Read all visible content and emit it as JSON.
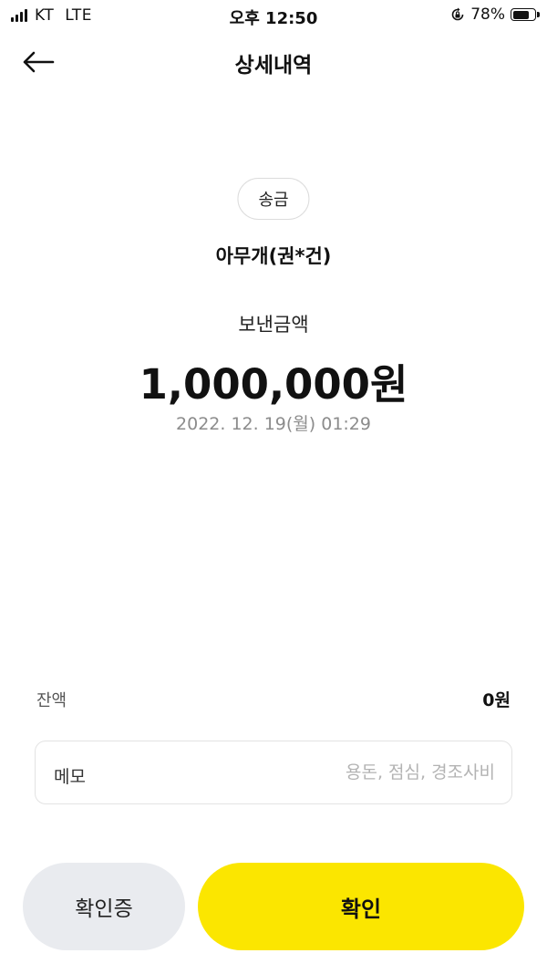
{
  "status_bar": {
    "carrier": "KT",
    "network": "LTE",
    "time": "오후 12:50",
    "battery_percent": "78%",
    "battery_level": 0.78,
    "icons": [
      "signal-icon",
      "rotation-lock-icon",
      "battery-icon"
    ]
  },
  "header": {
    "title": "상세내역",
    "back_icon": "arrow-left-icon"
  },
  "transaction": {
    "type": "송금",
    "recipient": "아무개(권*건)",
    "amount_label": "보낸금액",
    "amount": "1,000,000원",
    "datetime": "2022. 12. 19(월) 01:29"
  },
  "balance": {
    "label": "잔액",
    "value": "0원"
  },
  "memo": {
    "label": "메모",
    "placeholder": "용돈, 점심, 경조사비",
    "value": ""
  },
  "buttons": {
    "receipt_label": "확인증",
    "confirm_label": "확인"
  },
  "colors": {
    "accent_yellow": "#fbe600",
    "secondary_button": "#e9ebef",
    "muted_text": "#8c8c8c"
  }
}
